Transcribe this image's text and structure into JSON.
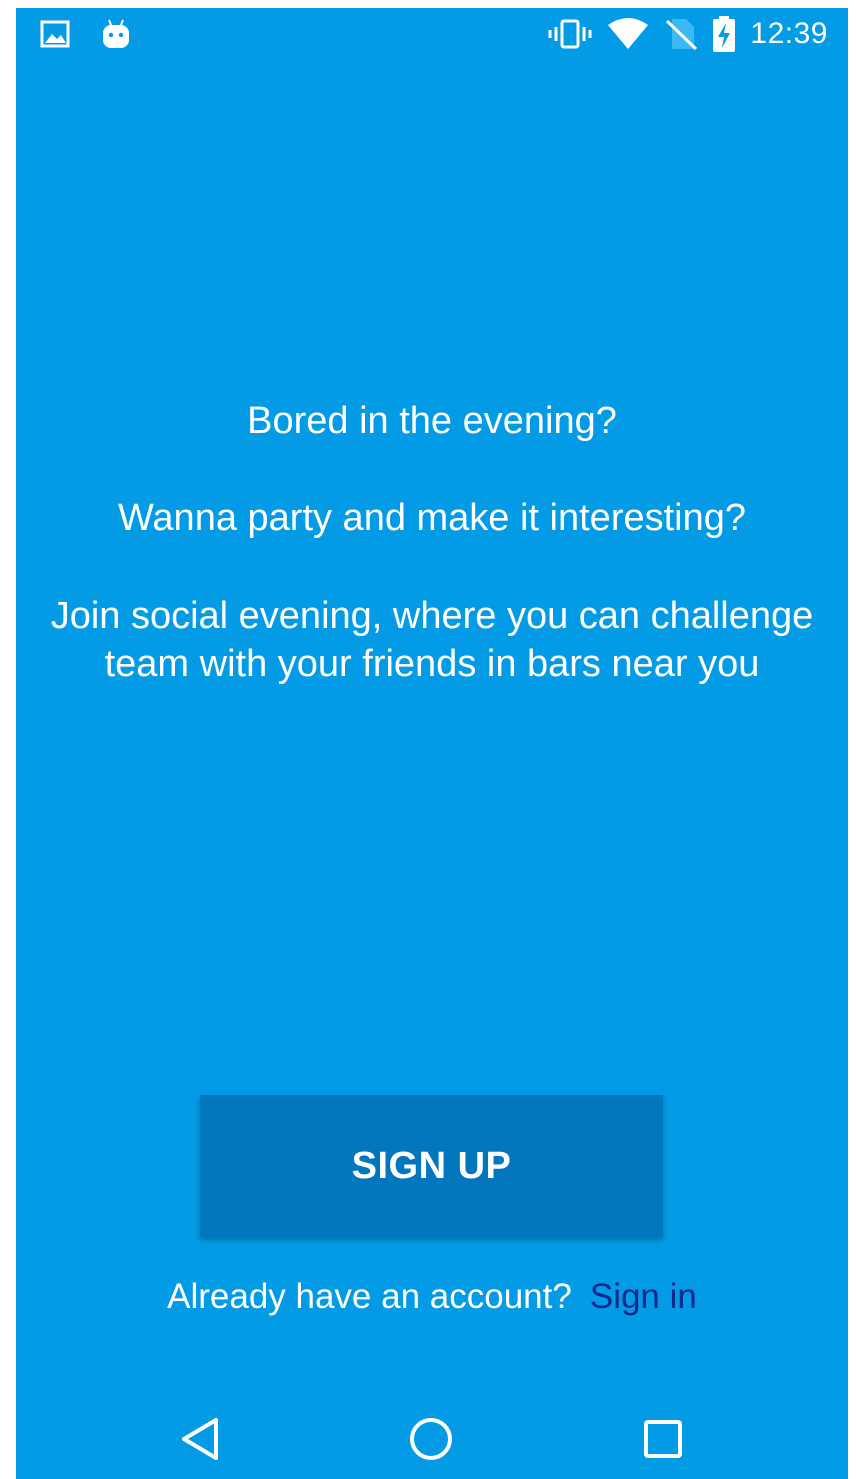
{
  "status_bar": {
    "time": "12:39",
    "left_icons": [
      "image-icon",
      "android-icon"
    ],
    "right_icons": [
      "vibrate-icon",
      "wifi-icon",
      "no-sim-icon",
      "battery-charging-icon"
    ]
  },
  "intro": {
    "line1": "Bored in the evening?",
    "line2": "Wanna party and make it interesting?",
    "line3": "Join social evening, where you can challenge team with your friends in bars near you"
  },
  "actions": {
    "signup_label": "SIGN UP",
    "signin_prompt": "Already have an account?",
    "signin_link": "Sign in"
  },
  "nav_bar": {
    "buttons": [
      "back-icon",
      "home-icon",
      "recents-icon"
    ]
  },
  "colors": {
    "background": "#039be5",
    "button": "#0277bd",
    "link": "#0d2a8c",
    "text": "#ffffff"
  }
}
